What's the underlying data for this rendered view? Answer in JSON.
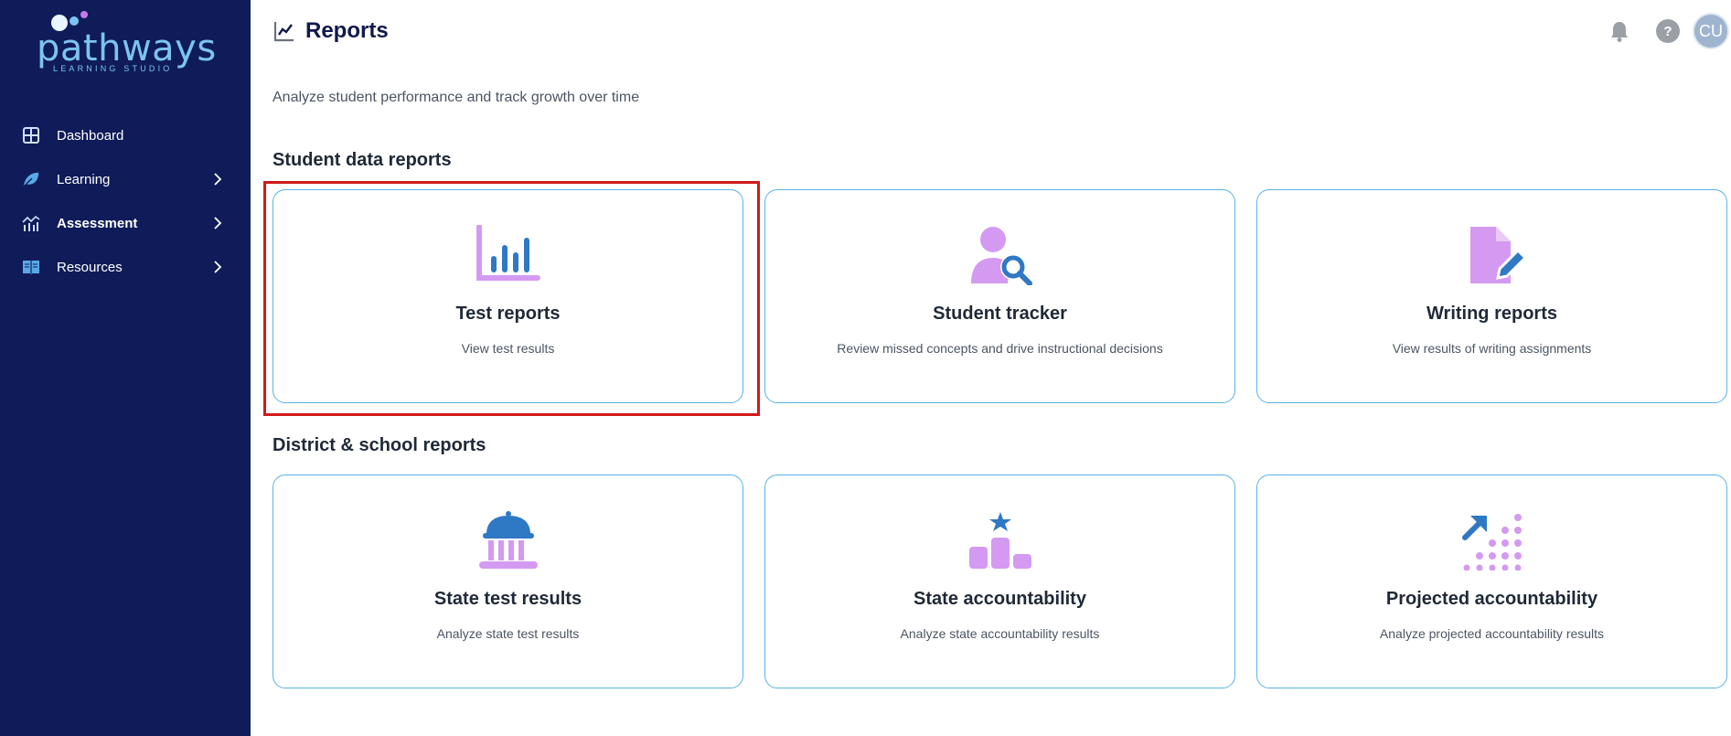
{
  "brand": {
    "name": "pathways",
    "tagline": "LEARNING STUDIO"
  },
  "sidebar": {
    "items": [
      {
        "label": "Dashboard",
        "icon": "dashboard-grid-icon",
        "has_chevron": false,
        "active": false
      },
      {
        "label": "Learning",
        "icon": "leaf-icon",
        "has_chevron": true,
        "active": false
      },
      {
        "label": "Assessment",
        "icon": "chart-bars-icon",
        "has_chevron": true,
        "active": true
      },
      {
        "label": "Resources",
        "icon": "book-icon",
        "has_chevron": true,
        "active": false
      }
    ]
  },
  "header": {
    "title": "Reports",
    "title_icon": "line-chart-icon",
    "help_label": "?",
    "avatar_initials": "CU"
  },
  "main": {
    "subtitle": "Analyze student performance and track growth over time",
    "sections": [
      {
        "title": "Student data reports",
        "cards": [
          {
            "title": "Test reports",
            "description": "View test results",
            "icon": "bar-chart-icon"
          },
          {
            "title": "Student tracker",
            "description": "Review missed concepts and drive instructional decisions",
            "icon": "person-search-icon"
          },
          {
            "title": "Writing reports",
            "description": "View results of writing assignments",
            "icon": "document-pen-icon"
          }
        ]
      },
      {
        "title": "District & school reports",
        "cards": [
          {
            "title": "State test results",
            "description": "Analyze state test results",
            "icon": "capitol-building-icon"
          },
          {
            "title": "State accountability",
            "description": "Analyze state accountability results",
            "icon": "podium-star-icon"
          },
          {
            "title": "Projected accountability",
            "description": "Analyze projected accountability results",
            "icon": "trend-dots-icon"
          }
        ]
      }
    ]
  },
  "colors": {
    "sidebar_bg": "#0f1c59",
    "accent_blue": "#2f78c4",
    "accent_purple": "#d49af2",
    "card_border": "#5ab3e6",
    "highlight": "#d11a1a"
  }
}
